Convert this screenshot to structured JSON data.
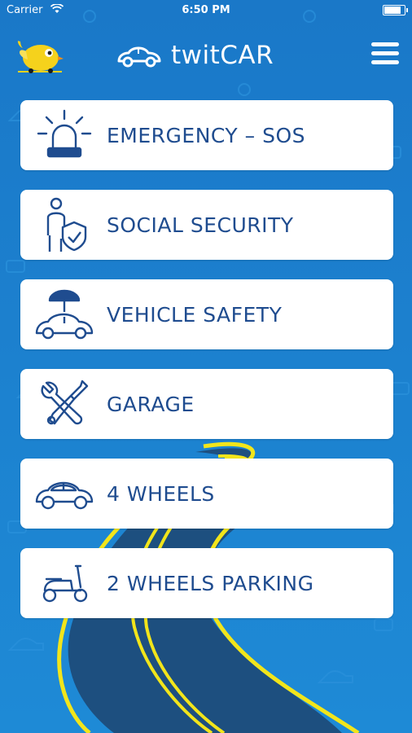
{
  "status_bar": {
    "carrier": "Carrier",
    "time": "6:50 PM"
  },
  "header": {
    "title": "twitCAR"
  },
  "menu": {
    "items": [
      {
        "label": "EMERGENCY – SOS",
        "icon": "siren-icon"
      },
      {
        "label": "SOCIAL SECURITY",
        "icon": "person-shield-icon"
      },
      {
        "label": "VEHICLE SAFETY",
        "icon": "car-umbrella-icon"
      },
      {
        "label": "GARAGE",
        "icon": "wrench-screwdriver-icon"
      },
      {
        "label": "4 WHEELS",
        "icon": "car-icon"
      },
      {
        "label": "2 WHEELS PARKING",
        "icon": "scooter-icon"
      }
    ]
  },
  "colors": {
    "background": "#1b7fcf",
    "card": "#ffffff",
    "label": "#1f4c8f",
    "road": "#1d4f7f",
    "road_line": "#f2e51b"
  }
}
